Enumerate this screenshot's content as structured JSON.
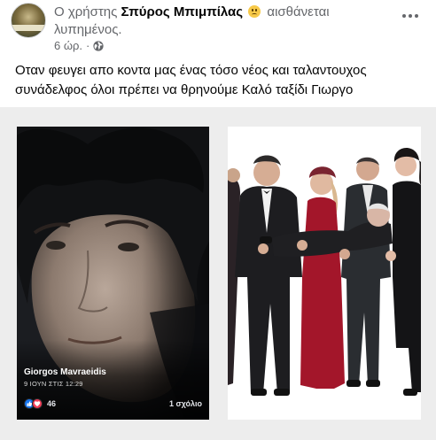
{
  "header": {
    "author": "Σπύρος Μπιμπίλας",
    "prefix": "Ο χρήστης ",
    "feeling": "αισθάνεται λυπημένος.",
    "feeling_icon": "sad-face-icon",
    "time": "6 ώρ.",
    "separator": "·",
    "privacy_icon": "globe-icon"
  },
  "post": {
    "text": "Οταν φευγει απο κοντα μας ένας τόσο νέος και ταλαντουχος συνάδελφος όλοι πρέπει να θρηνούμε Καλό ταξίδι Γιωργο"
  },
  "shared_post": {
    "name": "Giorgos Mavraeidis",
    "date": "9 ΙΟΥΝ ΣΤΙΣ 12:29",
    "reaction_count": "46",
    "comments": "1 σχόλιο",
    "reaction_icons": [
      "like-icon",
      "love-icon"
    ]
  },
  "colors": {
    "secondary_text": "#65676b",
    "primary_text": "#050505",
    "media_background": "#ededed",
    "like_blue": "#1877f2",
    "love_red": "#f33e58"
  }
}
